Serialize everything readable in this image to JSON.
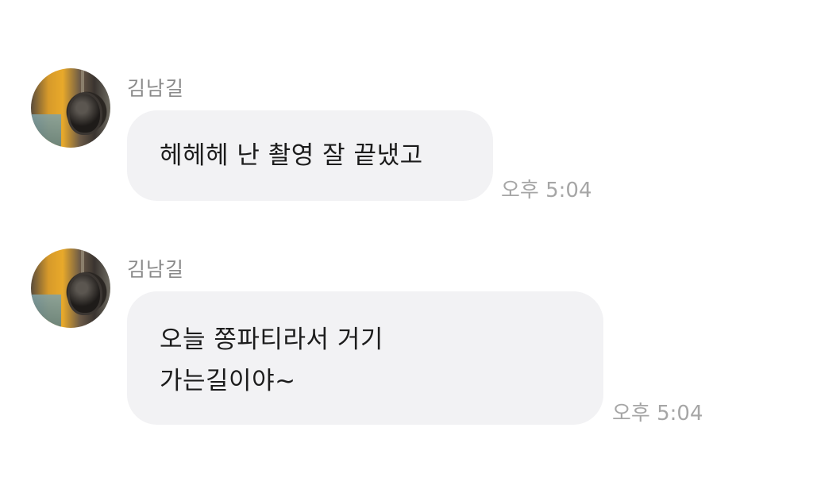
{
  "messages": [
    {
      "sender": "김남길",
      "text": "헤헤헤 난 촬영 잘 끝냈고",
      "time": "오후 5:04"
    },
    {
      "sender": "김남길",
      "lines": [
        "오늘 쫑파티라서 거기",
        "가는길이야~"
      ],
      "time": "오후 5:04"
    }
  ]
}
